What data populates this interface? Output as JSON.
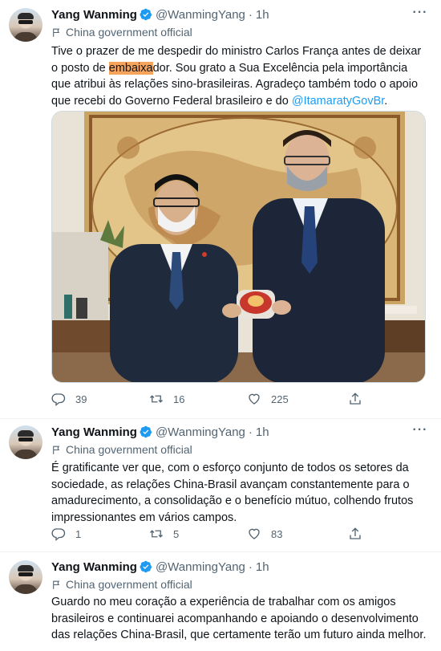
{
  "author": {
    "name": "Yang Wanming",
    "handle": "@WanmingYang",
    "separator": "·",
    "label": "China government official"
  },
  "tweets": [
    {
      "time": "1h",
      "text_pre": "Tive o prazer de me despedir do ministro Carlos França antes de deixar o posto de ",
      "text_highlight": "embaixa",
      "text_mid": "dor. Sou grato a Sua Excelência pela importância que atribui às relações sino-brasileiras. Agradeço também todo o apoio que recebi do Governo Federal brasileiro e do ",
      "mention": "@ItamaratyGovBr",
      "text_post": ".",
      "replies": "39",
      "retweets": "16",
      "likes": "225"
    },
    {
      "time": "1h",
      "text": "É gratificante ver que, com o esforço conjunto de todos os setores da sociedade, as relações China-Brasil avançam constantemente para o amadurecimento, a consolidação e o benefício mútuo, colhendo frutos impressionantes em vários campos.",
      "replies": "1",
      "retweets": "5",
      "likes": "83"
    },
    {
      "time": "1h",
      "text": "Guardo no meu coração a experiência de trabalhar com os amigos brasileiros e continuarei acompanhando e apoiando o desenvolvimento das relações China-Brasil, que certamente terão um futuro ainda melhor."
    }
  ],
  "icons": {
    "verified": "verified-badge-icon",
    "label": "government-flag-icon",
    "more": "more-options-icon",
    "reply": "reply-icon",
    "retweet": "retweet-icon",
    "like": "heart-icon",
    "share": "share-icon"
  },
  "colors": {
    "verified": "#1d9bf0",
    "mention": "#1d9bf0",
    "highlight": "#f6a35c",
    "secondary_text": "#536471"
  }
}
